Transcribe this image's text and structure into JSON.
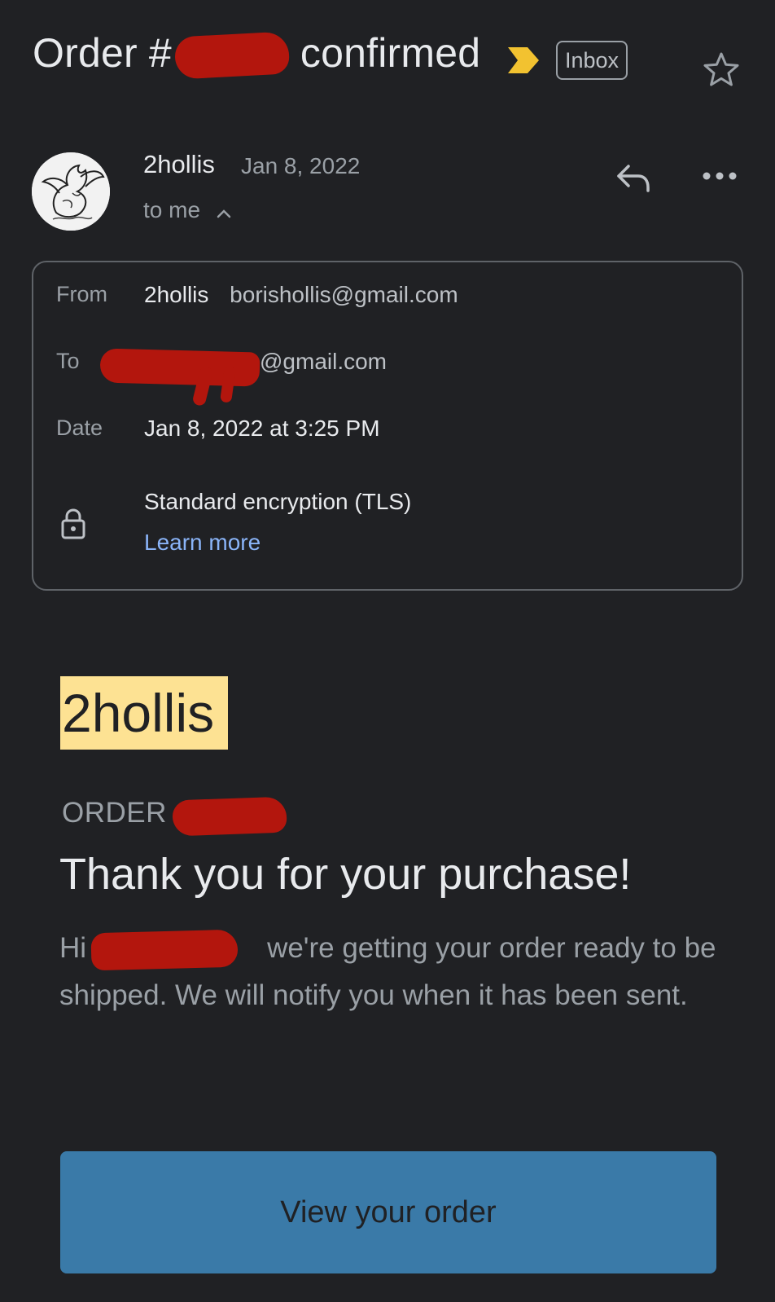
{
  "subject": {
    "prefix": "Order #",
    "suffix": "confirmed",
    "label_chip": "Inbox",
    "importance_color": "#f2c230"
  },
  "message": {
    "sender_name": "2hollis",
    "date": "Jan 8, 2022",
    "recipient_line": "to me"
  },
  "details": {
    "from_label": "From",
    "from_name": "2hollis",
    "from_email": "borishollis@gmail.com",
    "to_label": "To",
    "to_email_suffix": "@gmail.com",
    "date_label": "Date",
    "date_value": "Jan 8, 2022 at 3:25 PM",
    "encryption": "Standard encryption (TLS)",
    "learn_more": "Learn more"
  },
  "body": {
    "brand": "2hollis",
    "order_label": "ORDER",
    "heading": "Thank you for your purchase!",
    "greeting": "Hi",
    "paragraph": "we're getting your order ready to be shipped. We will notify you when it has been sent.",
    "button_label": "View your order"
  },
  "colors": {
    "background": "#202124",
    "link": "#8ab4f8",
    "brand_highlight": "#fde293",
    "button": "#3a7aa8",
    "redaction": "#b3160d"
  }
}
